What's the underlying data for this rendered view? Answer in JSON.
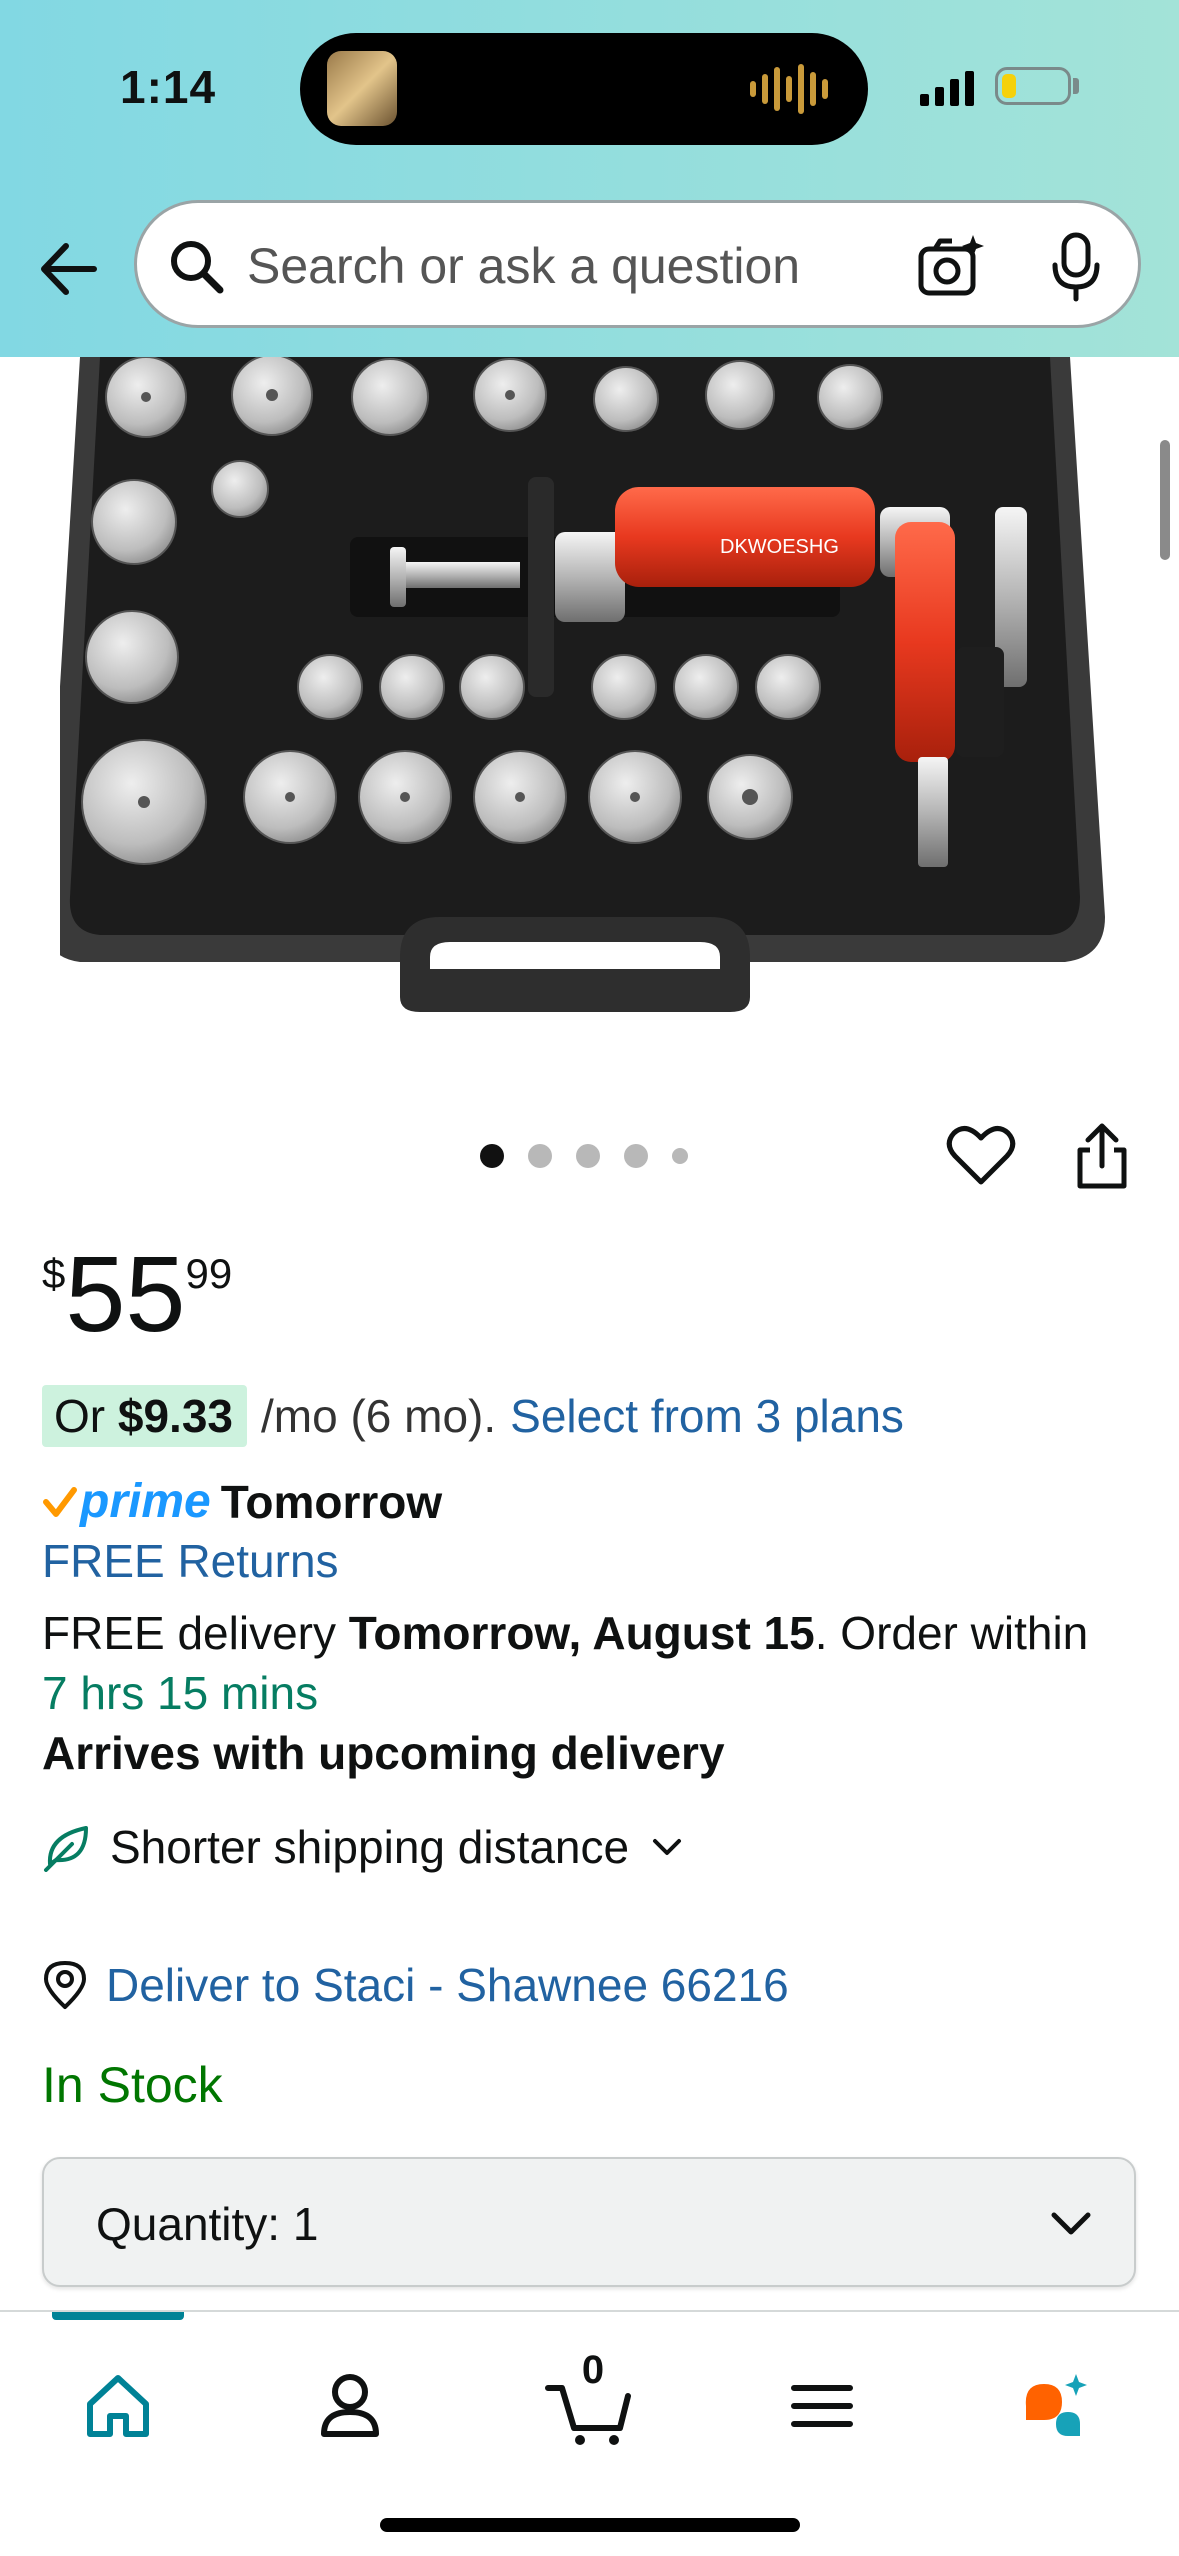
{
  "status_bar": {
    "time": "1:14"
  },
  "search": {
    "placeholder": "Search or ask a question"
  },
  "product": {
    "image_label": "DKWOESHG",
    "image_count": 5,
    "active_image": 1
  },
  "price": {
    "symbol": "$",
    "whole": "55",
    "fraction": "99"
  },
  "installment": {
    "prefix": "Or ",
    "amount": "$9.33",
    "term": "/mo (6 mo).",
    "link": "Select from 3 plans"
  },
  "delivery": {
    "prime_word": "prime",
    "prime_when": "Tomorrow",
    "free_returns": "FREE Returns",
    "free_delivery_prefix": "FREE delivery ",
    "delivery_date": "Tomorrow, August 15",
    "order_within_text": ". Order within",
    "countdown": "7 hrs 15 mins",
    "arrives_note": "Arrives with upcoming delivery",
    "shipping_label": "Shorter shipping distance",
    "deliver_to": "Deliver to Staci - Shawnee 66216",
    "stock_status": "In Stock"
  },
  "quantity": {
    "label": "Quantity:",
    "value": "1"
  },
  "bottom_nav": {
    "cart_count": "0"
  },
  "colors": {
    "link": "#2162a1",
    "in_stock": "#007600",
    "countdown": "#067d62",
    "prime_blue": "#1a98ff",
    "installment_chip": "#cdf2de",
    "nav_accent": "#008296",
    "pump_red": "#e8391f"
  }
}
